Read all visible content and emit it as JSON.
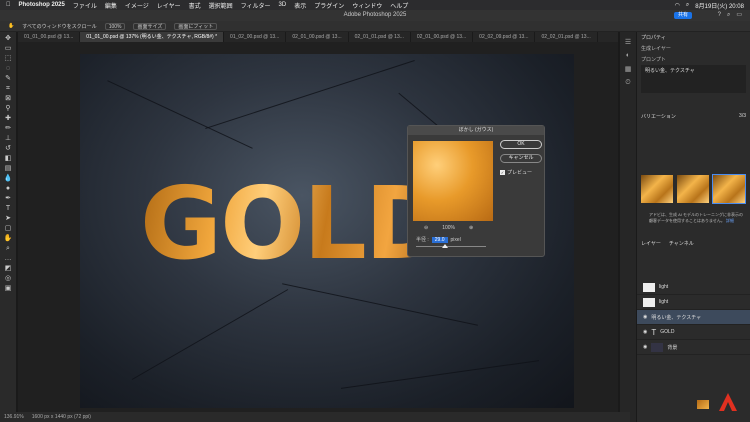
{
  "menubar": {
    "app": "Photoshop 2025",
    "items": [
      "ファイル",
      "編集",
      "イメージ",
      "レイヤー",
      "書式",
      "選択範囲",
      "フィルター",
      "3D",
      "表示",
      "プラグイン",
      "ウィンドウ",
      "ヘルプ"
    ],
    "clock": "8月19日(火) 20:08"
  },
  "window": {
    "title": "Adobe Photoshop 2025",
    "share_label": "共有"
  },
  "options": {
    "scroll_all": "すべてのウィンドウをスクロール",
    "zoom": "100%",
    "fit_screen": "画面サイズ",
    "fill_screen": "画面にフィット"
  },
  "tabs": [
    "01_01_00.psd @ 13...",
    "01_01_00.psd @ 137% (明るい金、テクスチャ, RGB/8#) *",
    "01_02_00.psd @ 13...",
    "02_01_00.psd @ 13...",
    "02_01_01.psd @ 13...",
    "02_01_00.psd @ 13...",
    "02_02_09.psd @ 13...",
    "02_02_01.psd @ 13..."
  ],
  "canvas": {
    "text": "GOLD"
  },
  "status": {
    "zoom": "136.91%",
    "doc": "1600 px x 1440 px (72 ppi)"
  },
  "dialog": {
    "title": "ぼかし (ガウス)",
    "ok": "OK",
    "cancel": "キャンセル",
    "preview": "プレビュー",
    "zoom": "100%",
    "radius_label": "半径 :",
    "radius_value": "29.0",
    "radius_unit": "pixel"
  },
  "properties": {
    "header": "プロパティ",
    "type": "生成レイヤー",
    "prompt_label": "プロンプト",
    "prompt": "明るい金、テクスチャ",
    "variations": "バリエーション",
    "variations_count": "3/3",
    "note": "アドビは、生成 AI モデルのトレーニングに非表示の顧客データを使用することはありません。",
    "link": "詳細"
  },
  "layers": {
    "tabs": [
      "レイヤー",
      "チャンネル"
    ],
    "items": [
      "light",
      "light",
      "明るい金、テクスチャ",
      "GOLD",
      "背景"
    ]
  },
  "colors": {
    "accent": "#1a73e8",
    "gold": "#e89a2a"
  }
}
